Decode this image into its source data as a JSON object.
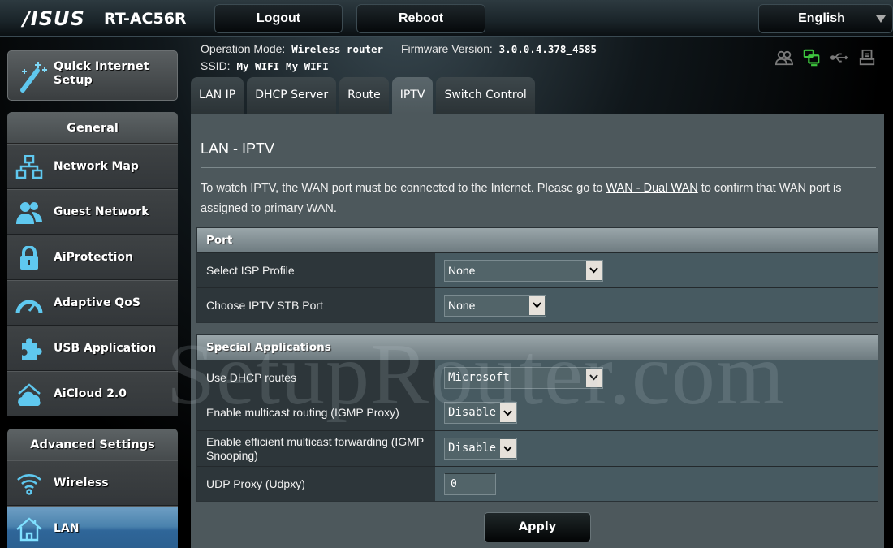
{
  "header": {
    "brand": "/ISUS",
    "model": "RT-AC56R",
    "logout_label": "Logout",
    "reboot_label": "Reboot",
    "language": "English"
  },
  "status": {
    "operation_mode_label": "Operation Mode:",
    "operation_mode_value": "Wireless router",
    "firmware_label": "Firmware Version:",
    "firmware_value": "3.0.0.4.378_4585",
    "ssid_label": "SSID:",
    "ssid_values": [
      "My WIFI",
      "My WIFI"
    ],
    "icons": [
      {
        "name": "clients-icon",
        "color": "#7a7a7a"
      },
      {
        "name": "network-connected-icon",
        "color": "#3ec43e"
      },
      {
        "name": "usb-icon",
        "color": "#7a7a7a"
      },
      {
        "name": "printer-icon",
        "color": "#7a7a7a"
      }
    ]
  },
  "sidebar": {
    "quick_setup_label": "Quick Internet Setup",
    "general_header": "General",
    "general_items": [
      {
        "label": "Network Map",
        "icon": "network-map-icon"
      },
      {
        "label": "Guest Network",
        "icon": "guest-network-icon"
      },
      {
        "label": "AiProtection",
        "icon": "lock-icon"
      },
      {
        "label": "Adaptive QoS",
        "icon": "speedometer-icon"
      },
      {
        "label": "USB Application",
        "icon": "puzzle-icon"
      },
      {
        "label": "AiCloud 2.0",
        "icon": "cloud-house-icon"
      }
    ],
    "advanced_header": "Advanced Settings",
    "advanced_items": [
      {
        "label": "Wireless",
        "icon": "wifi-icon",
        "active": false
      },
      {
        "label": "LAN",
        "icon": "house-icon",
        "active": true
      }
    ]
  },
  "tabs": [
    {
      "label": "LAN IP",
      "active": false
    },
    {
      "label": "DHCP Server",
      "active": false
    },
    {
      "label": "Route",
      "active": false
    },
    {
      "label": "IPTV",
      "active": true
    },
    {
      "label": "Switch Control",
      "active": false
    }
  ],
  "main": {
    "title": "LAN - IPTV",
    "description_before": "To watch IPTV, the WAN port must be connected to the Internet. Please go to ",
    "description_link": "WAN - Dual WAN",
    "description_after": " to confirm that WAN port is assigned to primary WAN.",
    "port_section": {
      "header": "Port",
      "rows": [
        {
          "label": "Select ISP Profile",
          "value": "None"
        },
        {
          "label": "Choose IPTV STB Port",
          "value": "None"
        }
      ]
    },
    "special_section": {
      "header": "Special Applications",
      "rows": [
        {
          "label": "Use DHCP routes",
          "value": "Microsoft"
        },
        {
          "label": "Enable multicast routing (IGMP Proxy)",
          "value": "Disable"
        },
        {
          "label": "Enable efficient multicast forwarding (IGMP Snooping)",
          "value": "Disable"
        },
        {
          "label": "UDP Proxy (Udpxy)",
          "value": "0"
        }
      ]
    },
    "apply_label": "Apply"
  },
  "watermark": "SetupRouter.com",
  "colors": {
    "active_nav": "#3a74a6",
    "icon_glow": "#5fc8ef",
    "status_green": "#3ec43e"
  }
}
